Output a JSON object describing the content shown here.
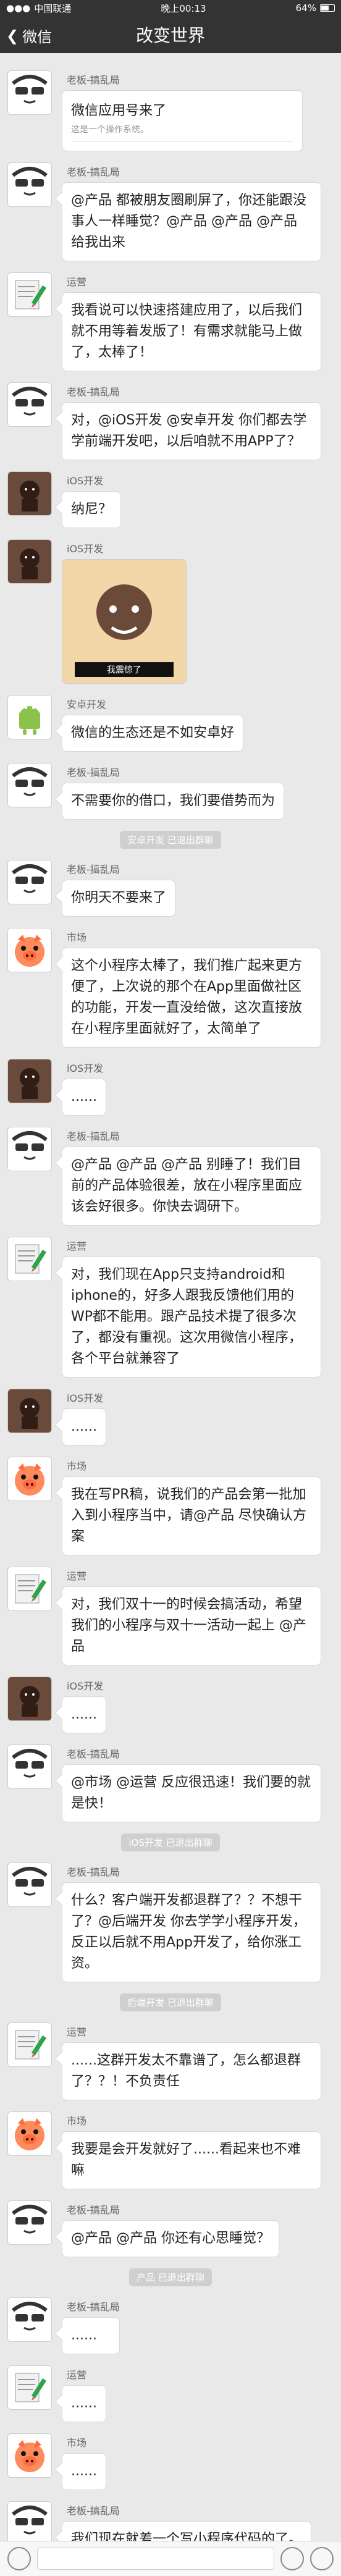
{
  "status": {
    "carrier": "中国联通",
    "time": "晚上00:13",
    "battery": "64%"
  },
  "nav": {
    "back_label": "微信",
    "title": "改变世界"
  },
  "messages": [
    {
      "sender": "老板-搞乱局",
      "avatar": "face",
      "type": "share",
      "share_title": "微信应用号来了",
      "share_subtitle": "这是一个操作系统。"
    },
    {
      "sender": "老板-搞乱局",
      "avatar": "face",
      "type": "text",
      "text": "@产品 都被朋友圈刷屏了，你还能跟没事人一样睡觉？@产品 @产品 @产品 给我出来"
    },
    {
      "sender": "运营",
      "avatar": "memo",
      "type": "text",
      "text": "我看说可以快速搭建应用了，以后我们就不用等着发版了！有需求就能马上做了，太棒了！"
    },
    {
      "sender": "老板-搞乱局",
      "avatar": "face",
      "type": "text",
      "text": "对，@iOS开发 @安卓开发 你们都去学学前端开发吧，以后咱就不用APP了？"
    },
    {
      "sender": "iOS开发",
      "avatar": "photo",
      "type": "text",
      "text": "纳尼？"
    },
    {
      "sender": "iOS开发",
      "avatar": "photo",
      "type": "meme",
      "meme_text": "我震惊了"
    },
    {
      "sender": "安卓开发",
      "avatar": "android",
      "type": "text",
      "text": "微信的生态还是不如安卓好"
    },
    {
      "sender": "老板-搞乱局",
      "avatar": "face",
      "type": "text",
      "text": "不需要你的借口，我们要借势而为"
    },
    {
      "system": "安卓开发 已退出群聊"
    },
    {
      "sender": "老板-搞乱局",
      "avatar": "face",
      "type": "text",
      "text": "你明天不要来了"
    },
    {
      "sender": "市场",
      "avatar": "pig",
      "type": "text",
      "text": "这个小程序太棒了，我们推广起来更方便了，上次说的那个在App里面做社区的功能，开发一直没给做，这次直接放在小程序里面就好了，太简单了"
    },
    {
      "sender": "iOS开发",
      "avatar": "photo",
      "type": "text",
      "text": "......"
    },
    {
      "sender": "老板-搞乱局",
      "avatar": "face",
      "type": "text",
      "text": "@产品 @产品 @产品 别睡了！我们目前的产品体验很差，放在小程序里面应该会好很多。你快去调研下。"
    },
    {
      "sender": "运营",
      "avatar": "memo",
      "type": "text",
      "text": "对，我们现在App只支持android和iphone的，好多人跟我反馈他们用的WP都不能用。跟产品技术提了很多次了，都没有重视。这次用微信小程序，各个平台就兼容了"
    },
    {
      "sender": "iOS开发",
      "avatar": "photo",
      "type": "text",
      "text": "......"
    },
    {
      "sender": "市场",
      "avatar": "pig",
      "type": "text",
      "text": "我在写PR稿，说我们的产品会第一批加入到小程序当中，请@产品 尽快确认方案"
    },
    {
      "sender": "运营",
      "avatar": "memo",
      "type": "text",
      "text": "对，我们双十一的时候会搞活动，希望我们的小程序与双十一活动一起上 @产品"
    },
    {
      "sender": "iOS开发",
      "avatar": "photo",
      "type": "text",
      "text": "......"
    },
    {
      "sender": "老板-搞乱局",
      "avatar": "face",
      "type": "text",
      "text": "@市场 @运营 反应很迅速！我们要的就是快！"
    },
    {
      "system": "iOS开发 已退出群聊"
    },
    {
      "sender": "老板-搞乱局",
      "avatar": "face",
      "type": "text",
      "text": "什么？客户端开发都退群了？？不想干了？@后端开发 你去学学小程序开发，反正以后就不用App开发了，给你涨工资。"
    },
    {
      "system": "后端开发 已退出群聊"
    },
    {
      "sender": "运营",
      "avatar": "memo",
      "type": "text",
      "text": "......这群开发太不靠谱了，怎么都退群了？？！不负责任"
    },
    {
      "sender": "市场",
      "avatar": "pig",
      "type": "text",
      "text": "我要是会开发就好了......看起来也不难嘛"
    },
    {
      "sender": "老板-搞乱局",
      "avatar": "face",
      "type": "text",
      "text": "@产品 @产品 你还有心思睡觉？"
    },
    {
      "system": "产品 已退出群聊"
    },
    {
      "sender": "老板-搞乱局",
      "avatar": "face",
      "type": "text",
      "text": "......"
    },
    {
      "sender": "运营",
      "avatar": "memo",
      "type": "text",
      "text": "......"
    },
    {
      "sender": "市场",
      "avatar": "pig",
      "type": "text",
      "text": "......"
    },
    {
      "sender": "老板-搞乱局",
      "avatar": "face",
      "type": "text",
      "text": "我们现在就差一个写小程序代码的了。"
    }
  ]
}
